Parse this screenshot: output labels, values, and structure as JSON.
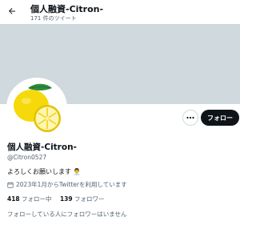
{
  "header": {
    "title": "個人融資-Citron-",
    "tweet_count": "171 件のツイート",
    "back_icon": "arrow-left-icon"
  },
  "profile": {
    "display_name": "個人融資-Citron-",
    "handle": "@Citron0527",
    "bio": "よろしくお願いします",
    "bio_emoji": "👨‍💼",
    "joined": "2023年1月からTwitterを利用しています",
    "following_count": "418",
    "following_label": "フォロー中",
    "followers_count": "139",
    "followers_label": "フォロワー",
    "followers_note": "フォローしている人にフォロワーはいません"
  },
  "actions": {
    "more_icon": "more-horizontal-icon",
    "follow_label": "フォロー"
  },
  "colors": {
    "banner": "#cfd9de",
    "text_secondary": "#536471",
    "button_dark": "#0f1419",
    "lemon": "#f5d90a",
    "leaf": "#2e8b3a"
  }
}
